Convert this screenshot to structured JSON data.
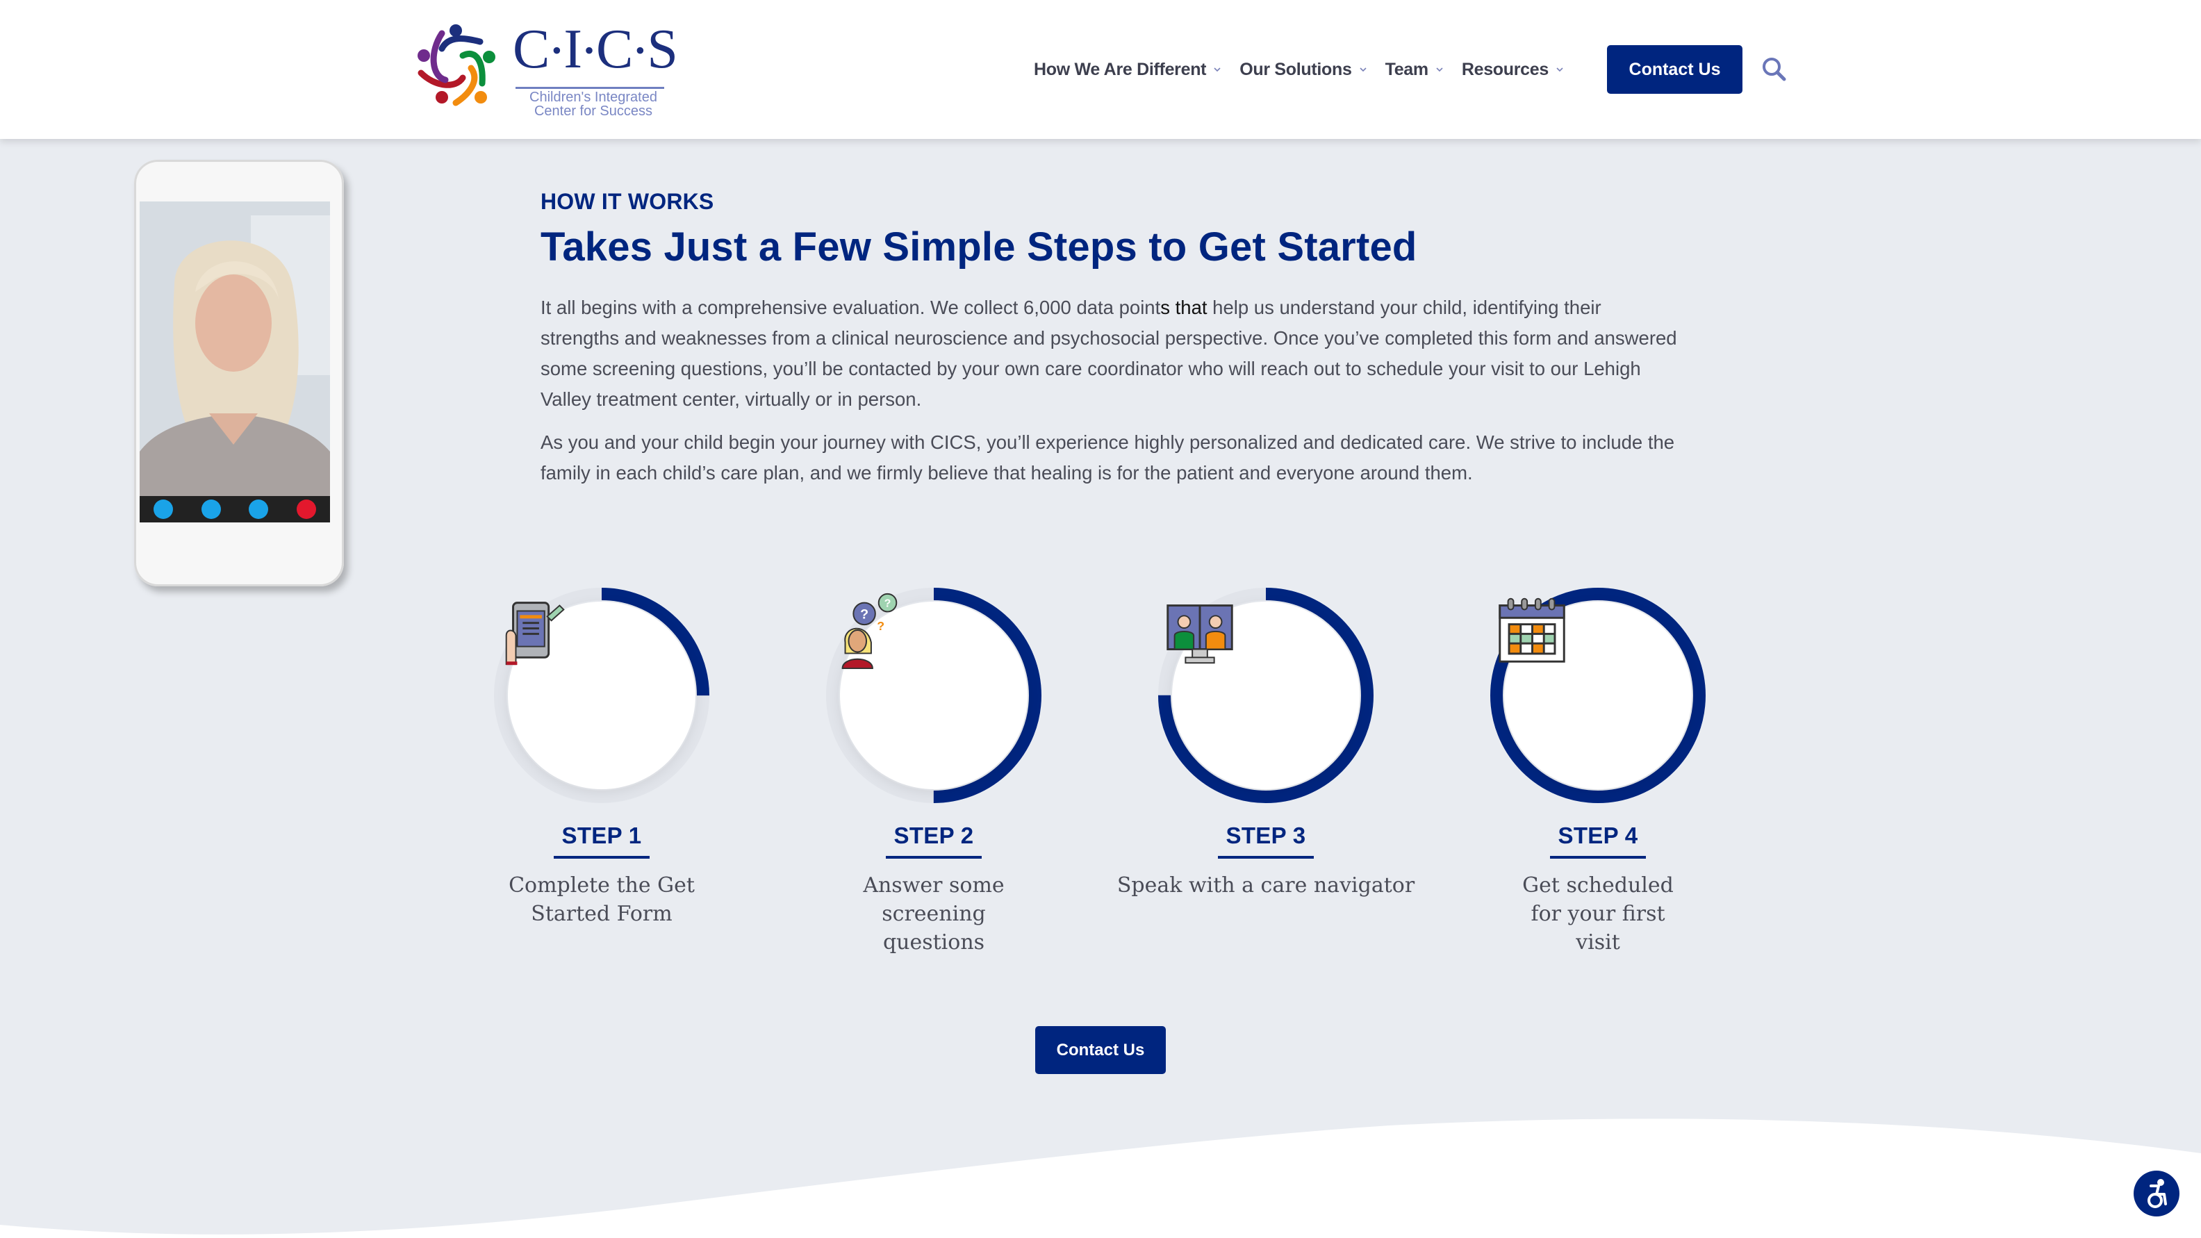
{
  "header": {
    "logo": {
      "wordmark_letters": [
        "C",
        "I",
        "C",
        "S"
      ],
      "tagline_line1": "Children's Integrated",
      "tagline_line2": "Center for Success",
      "alt": "CICS Children's Integrated Center for Success"
    },
    "nav": [
      {
        "label": "How We Are Different",
        "has_dropdown": true
      },
      {
        "label": "Our Solutions",
        "has_dropdown": true
      },
      {
        "label": "Team",
        "has_dropdown": true
      },
      {
        "label": "Resources",
        "has_dropdown": true
      }
    ],
    "contact_label": "Contact Us",
    "search_icon": "search-icon"
  },
  "hero": {
    "phone_image": {
      "description": "Woman on video call displayed on a smartphone",
      "call_controls": [
        "video-icon",
        "signal-icon",
        "chat-icon",
        "end-call-icon"
      ]
    },
    "eyebrow": "HOW IT WORKS",
    "title": "Takes Just a Few Simple Steps to Get Started",
    "paragraph1_a": "It all begins with a comprehensive evaluation. We collect 6,000 data point",
    "paragraph1_highlight": "s that",
    "paragraph1_b": " help us understand your child, identifying their strengths and weaknesses from a clinical neuroscience and psychosocial perspective. Once you’ve completed this form and answered some screening questions, you’ll be contacted by your own care coordinator who will reach out to schedule your visit to our Lehigh Valley treatment center, virtually or in person.",
    "paragraph2": "As you and your child begin your journey with CICS, you’ll experience highly personalized and dedicated care. We strive to include the family in each child’s care plan, and we firmly believe that healing is for the patient and everyone around them."
  },
  "steps": [
    {
      "label": "STEP 1",
      "description": "Complete the Get Started Form",
      "progress": 0.25,
      "icon": "tablet-form-icon"
    },
    {
      "label": "STEP 2",
      "description": "Answer some screening questions",
      "progress": 0.5,
      "icon": "questions-person-icon"
    },
    {
      "label": "STEP 3",
      "description": "Speak with a care navigator",
      "progress": 0.75,
      "icon": "video-call-monitor-icon"
    },
    {
      "label": "STEP 4",
      "description": "Get scheduled for your first visit",
      "progress": 1.0,
      "icon": "calendar-icon"
    }
  ],
  "cta": {
    "label": "Contact Us"
  },
  "accessibility_button": {
    "icon": "accessibility-icon"
  },
  "colors": {
    "brand_navy": "#00257f",
    "background": "#e9ecf1",
    "ring_track": "#e1e4ea",
    "body_text": "#4a4c57",
    "search_icon": "#6a76b8"
  }
}
